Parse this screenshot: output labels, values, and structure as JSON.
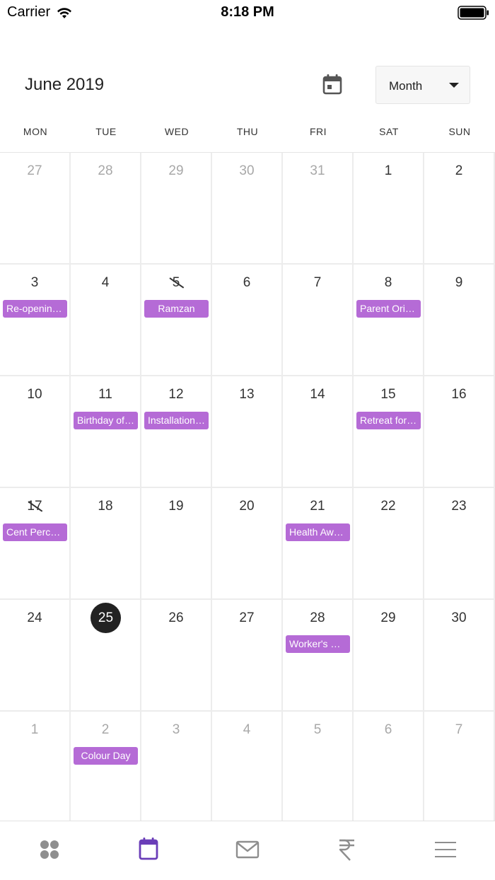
{
  "status_bar": {
    "carrier": "Carrier",
    "time": "8:18 PM"
  },
  "header": {
    "title": "June 2019",
    "view_label": "Month"
  },
  "weekdays": [
    "MON",
    "TUE",
    "WED",
    "THU",
    "FRI",
    "SAT",
    "SUN"
  ],
  "weeks": [
    [
      {
        "num": "27",
        "muted": true
      },
      {
        "num": "28",
        "muted": true
      },
      {
        "num": "29",
        "muted": true
      },
      {
        "num": "30",
        "muted": true
      },
      {
        "num": "31",
        "muted": true
      },
      {
        "num": "1"
      },
      {
        "num": "2"
      }
    ],
    [
      {
        "num": "3",
        "event": "Re-opening of School"
      },
      {
        "num": "4"
      },
      {
        "num": "5",
        "holiday": true,
        "event": "Ramzan"
      },
      {
        "num": "6"
      },
      {
        "num": "7"
      },
      {
        "num": "8",
        "event": "Parent Orientation"
      },
      {
        "num": "9"
      }
    ],
    [
      {
        "num": "10"
      },
      {
        "num": "11",
        "event": "Birthday of Principal"
      },
      {
        "num": "12",
        "event": "Installation Ceremony"
      },
      {
        "num": "13"
      },
      {
        "num": "14"
      },
      {
        "num": "15",
        "event": "Retreat for Teachers"
      },
      {
        "num": "16"
      }
    ],
    [
      {
        "num": "17",
        "holiday": true,
        "event": "Cent Percent Result"
      },
      {
        "num": "18"
      },
      {
        "num": "19"
      },
      {
        "num": "20"
      },
      {
        "num": "21",
        "event": "Health Awareness"
      },
      {
        "num": "22"
      },
      {
        "num": "23"
      }
    ],
    [
      {
        "num": "24"
      },
      {
        "num": "25",
        "today": true
      },
      {
        "num": "26"
      },
      {
        "num": "27"
      },
      {
        "num": "28",
        "event": "Worker's Day"
      },
      {
        "num": "29"
      },
      {
        "num": "30"
      }
    ],
    [
      {
        "num": "1",
        "muted": true
      },
      {
        "num": "2",
        "muted": true,
        "event": "Colour Day"
      },
      {
        "num": "3",
        "muted": true
      },
      {
        "num": "4",
        "muted": true
      },
      {
        "num": "5",
        "muted": true
      },
      {
        "num": "6",
        "muted": true
      },
      {
        "num": "7",
        "muted": true
      }
    ]
  ],
  "tabs": [
    {
      "name": "dashboard-icon",
      "active": false
    },
    {
      "name": "calendar-icon",
      "active": true
    },
    {
      "name": "mail-icon",
      "active": false
    },
    {
      "name": "rupee-icon",
      "active": false
    },
    {
      "name": "menu-icon",
      "active": false
    }
  ],
  "colors": {
    "event": "#b56bd6",
    "accent": "#6a3db8",
    "today": "#222222",
    "tab_inactive": "#8e8e8e"
  }
}
